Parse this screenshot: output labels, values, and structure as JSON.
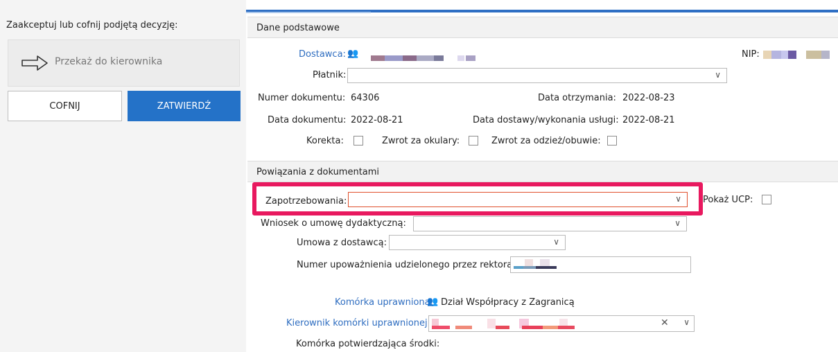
{
  "left": {
    "title": "Zaakceptuj lub cofnij podjętą decyzję:",
    "forward_label": "Przekaż do kierownika",
    "cofnij_label": "COFNIJ",
    "zatwierdz_label": "ZATWIERDŹ"
  },
  "sections": {
    "basic": "Dane podstawowe",
    "links": "Powiązania z dokumentami"
  },
  "basic": {
    "dostawca_label": "Dostawca:",
    "nip_label": "NIP:",
    "platnik_label": "Płatnik:",
    "platnik_value": "",
    "numer_label": "Numer dokumentu:",
    "numer_value": "64306",
    "data_otrz_label": "Data otrzymania:",
    "data_otrz_value": "2022-08-23",
    "data_dok_label": "Data dokumentu:",
    "data_dok_value": "2022-08-21",
    "data_dost_label": "Data dostawy/wykonania usługi:",
    "data_dost_value": "2022-08-21",
    "korekta_label": "Korekta:",
    "zwrot_okulary_label": "Zwrot za okulary:",
    "zwrot_odziez_label": "Zwrot za odzież/obuwie:"
  },
  "links": {
    "zapotrzebowania_label": "Zapotrzebowania:",
    "zapotrzebowania_value": "",
    "pokaz_ucp_label": "Pokaż UCP:",
    "wniosek_label": "Wniosek o umowę dydaktyczną:",
    "wniosek_value": "",
    "umowa_label": "Umowa z dostawcą:",
    "umowa_value": "",
    "numer_upow_label": "Numer upoważnienia udzielonego przez rektora:",
    "komorka_upr_label": "Komórka uprawniona:",
    "komorka_upr_value": "Dział Współpracy z Zagranicą",
    "kierownik_label": "Kierownik komórki uprawnionej:",
    "komorka_potw_label": "Komórka potwierdzająca środki:"
  },
  "icons": {
    "arrow": "right-arrow-outline",
    "chevron": "chevron-down",
    "people": "people-icon",
    "clear": "clear-x"
  },
  "colors": {
    "accent": "#2472c8",
    "link": "#2e6dc0",
    "highlight": "#e8195f",
    "error_border": "#e0502d"
  }
}
